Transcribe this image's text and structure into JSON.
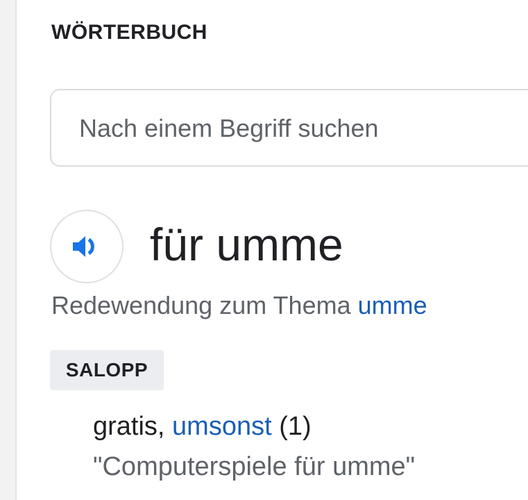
{
  "section": {
    "title": "WÖRTERBUCH"
  },
  "search": {
    "placeholder": "Nach einem Begriff suchen",
    "value": ""
  },
  "entry": {
    "speaker_icon": "volume-icon",
    "headword": "für umme",
    "subline_prefix": "Redewendung zum Thema ",
    "subline_link": "umme",
    "badge": "SALOPP",
    "meaning_prefix": "gratis, ",
    "meaning_link": "umsonst",
    "meaning_suffix": " (1)",
    "example": "\"Computerspiele für umme\""
  },
  "colors": {
    "link": "#1a5fb4",
    "speaker_icon": "#1a73e8",
    "badge_bg": "#ebedf0"
  }
}
